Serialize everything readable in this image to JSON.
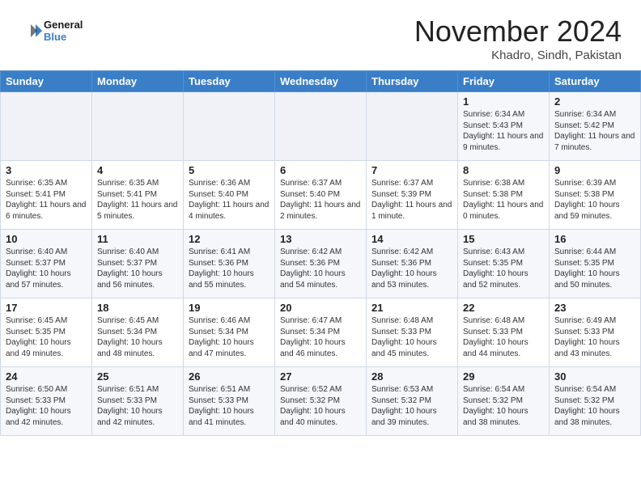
{
  "header": {
    "logo_line1": "General",
    "logo_line2": "Blue",
    "month": "November 2024",
    "location": "Khadro, Sindh, Pakistan"
  },
  "weekdays": [
    "Sunday",
    "Monday",
    "Tuesday",
    "Wednesday",
    "Thursday",
    "Friday",
    "Saturday"
  ],
  "weeks": [
    [
      {
        "day": "",
        "content": ""
      },
      {
        "day": "",
        "content": ""
      },
      {
        "day": "",
        "content": ""
      },
      {
        "day": "",
        "content": ""
      },
      {
        "day": "",
        "content": ""
      },
      {
        "day": "1",
        "content": "Sunrise: 6:34 AM\nSunset: 5:43 PM\nDaylight: 11 hours and 9 minutes."
      },
      {
        "day": "2",
        "content": "Sunrise: 6:34 AM\nSunset: 5:42 PM\nDaylight: 11 hours and 7 minutes."
      }
    ],
    [
      {
        "day": "3",
        "content": "Sunrise: 6:35 AM\nSunset: 5:41 PM\nDaylight: 11 hours and 6 minutes."
      },
      {
        "day": "4",
        "content": "Sunrise: 6:35 AM\nSunset: 5:41 PM\nDaylight: 11 hours and 5 minutes."
      },
      {
        "day": "5",
        "content": "Sunrise: 6:36 AM\nSunset: 5:40 PM\nDaylight: 11 hours and 4 minutes."
      },
      {
        "day": "6",
        "content": "Sunrise: 6:37 AM\nSunset: 5:40 PM\nDaylight: 11 hours and 2 minutes."
      },
      {
        "day": "7",
        "content": "Sunrise: 6:37 AM\nSunset: 5:39 PM\nDaylight: 11 hours and 1 minute."
      },
      {
        "day": "8",
        "content": "Sunrise: 6:38 AM\nSunset: 5:38 PM\nDaylight: 11 hours and 0 minutes."
      },
      {
        "day": "9",
        "content": "Sunrise: 6:39 AM\nSunset: 5:38 PM\nDaylight: 10 hours and 59 minutes."
      }
    ],
    [
      {
        "day": "10",
        "content": "Sunrise: 6:40 AM\nSunset: 5:37 PM\nDaylight: 10 hours and 57 minutes."
      },
      {
        "day": "11",
        "content": "Sunrise: 6:40 AM\nSunset: 5:37 PM\nDaylight: 10 hours and 56 minutes."
      },
      {
        "day": "12",
        "content": "Sunrise: 6:41 AM\nSunset: 5:36 PM\nDaylight: 10 hours and 55 minutes."
      },
      {
        "day": "13",
        "content": "Sunrise: 6:42 AM\nSunset: 5:36 PM\nDaylight: 10 hours and 54 minutes."
      },
      {
        "day": "14",
        "content": "Sunrise: 6:42 AM\nSunset: 5:36 PM\nDaylight: 10 hours and 53 minutes."
      },
      {
        "day": "15",
        "content": "Sunrise: 6:43 AM\nSunset: 5:35 PM\nDaylight: 10 hours and 52 minutes."
      },
      {
        "day": "16",
        "content": "Sunrise: 6:44 AM\nSunset: 5:35 PM\nDaylight: 10 hours and 50 minutes."
      }
    ],
    [
      {
        "day": "17",
        "content": "Sunrise: 6:45 AM\nSunset: 5:35 PM\nDaylight: 10 hours and 49 minutes."
      },
      {
        "day": "18",
        "content": "Sunrise: 6:45 AM\nSunset: 5:34 PM\nDaylight: 10 hours and 48 minutes."
      },
      {
        "day": "19",
        "content": "Sunrise: 6:46 AM\nSunset: 5:34 PM\nDaylight: 10 hours and 47 minutes."
      },
      {
        "day": "20",
        "content": "Sunrise: 6:47 AM\nSunset: 5:34 PM\nDaylight: 10 hours and 46 minutes."
      },
      {
        "day": "21",
        "content": "Sunrise: 6:48 AM\nSunset: 5:33 PM\nDaylight: 10 hours and 45 minutes."
      },
      {
        "day": "22",
        "content": "Sunrise: 6:48 AM\nSunset: 5:33 PM\nDaylight: 10 hours and 44 minutes."
      },
      {
        "day": "23",
        "content": "Sunrise: 6:49 AM\nSunset: 5:33 PM\nDaylight: 10 hours and 43 minutes."
      }
    ],
    [
      {
        "day": "24",
        "content": "Sunrise: 6:50 AM\nSunset: 5:33 PM\nDaylight: 10 hours and 42 minutes."
      },
      {
        "day": "25",
        "content": "Sunrise: 6:51 AM\nSunset: 5:33 PM\nDaylight: 10 hours and 42 minutes."
      },
      {
        "day": "26",
        "content": "Sunrise: 6:51 AM\nSunset: 5:33 PM\nDaylight: 10 hours and 41 minutes."
      },
      {
        "day": "27",
        "content": "Sunrise: 6:52 AM\nSunset: 5:32 PM\nDaylight: 10 hours and 40 minutes."
      },
      {
        "day": "28",
        "content": "Sunrise: 6:53 AM\nSunset: 5:32 PM\nDaylight: 10 hours and 39 minutes."
      },
      {
        "day": "29",
        "content": "Sunrise: 6:54 AM\nSunset: 5:32 PM\nDaylight: 10 hours and 38 minutes."
      },
      {
        "day": "30",
        "content": "Sunrise: 6:54 AM\nSunset: 5:32 PM\nDaylight: 10 hours and 38 minutes."
      }
    ]
  ]
}
